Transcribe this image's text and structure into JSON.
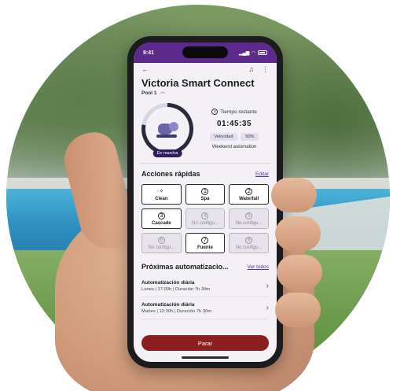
{
  "status_bar": {
    "time": "9:41"
  },
  "header": {
    "back": "←",
    "bell": "🔔",
    "more": "⋮"
  },
  "title": "Victoria Smart Connect",
  "subtitle": "Pool 1",
  "status": {
    "badge": "En marcha",
    "time_label": "Tiempo restante",
    "time": "01:45:35",
    "speed_label": "Velocidad",
    "speed_value": "50%",
    "automation": "Weekend automation"
  },
  "quick_actions": {
    "title": "Acciones rápidas",
    "edit": "Editar",
    "items": [
      {
        "icon": "✧",
        "label": "Clean"
      },
      {
        "icon": "1",
        "label": "Spa"
      },
      {
        "icon": "2",
        "label": "Waterfall"
      },
      {
        "icon": "3",
        "label": "Cascade"
      },
      {
        "icon": "4",
        "label": "No configu..."
      },
      {
        "icon": "5",
        "label": "No configu..."
      },
      {
        "icon": "6",
        "label": "No configu..."
      },
      {
        "icon": "7",
        "label": "Fuente"
      },
      {
        "icon": "8",
        "label": "No configu..."
      }
    ]
  },
  "automations": {
    "title": "Próximas automatizacio...",
    "see_all": "Ver todos",
    "items": [
      {
        "title": "Automatización diária",
        "detail": "Lunes | 17:00h | Duración 7h 30m"
      },
      {
        "title": "Automatización diária",
        "detail": "Martes | 12:30h | Duración 7h 30m"
      }
    ]
  },
  "stop_button": "Parar"
}
